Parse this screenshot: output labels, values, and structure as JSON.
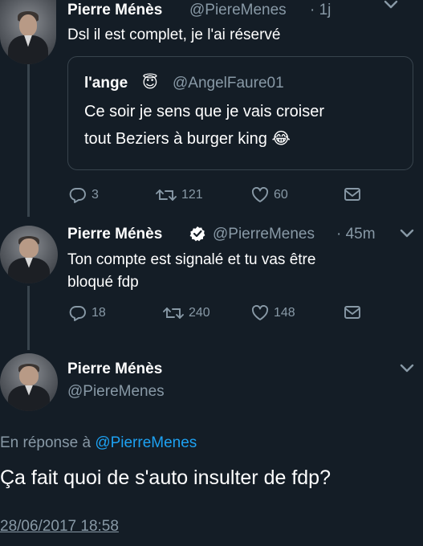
{
  "tweet1": {
    "author_name": "Pierre Ménès",
    "handle": "@PiereMenes",
    "time": "· 1j",
    "text": "Dsl il est complet, je l'ai réservé",
    "quoted": {
      "author_name": "l'ange",
      "author_emoji": "😇",
      "handle": "@AngelFaure01",
      "text_line1": "Ce soir je sens que je vais croiser",
      "text_line2": "tout Beziers à burger king",
      "text_emoji": "😂"
    },
    "replies": "3",
    "retweets": "121",
    "likes": "60"
  },
  "tweet2": {
    "author_name": "Pierre Ménès",
    "verified": true,
    "handle": "@PierreMenes",
    "time": "· 45m",
    "text_line1": "Ton compte est signalé et tu vas être",
    "text_line2": "bloqué fdp",
    "replies": "18",
    "retweets": "240",
    "likes": "148"
  },
  "tweet3": {
    "author_name": "Pierre Ménès",
    "handle": "@PiereMenes",
    "reply_prefix": "En réponse à ",
    "reply_mention": "@PierreMenes",
    "text": "Ça fait quoi de s'auto insulter de fdp?",
    "timestamp": "28/06/2017 18:58"
  },
  "colors": {
    "background": "#141d26",
    "primary_text": "#ffffff",
    "secondary_text": "#8899a6",
    "accent": "#1da1f2",
    "border": "#38444d"
  },
  "icons": {
    "reply": "reply-icon",
    "retweet": "retweet-icon",
    "like": "heart-icon",
    "dm": "envelope-icon",
    "menu": "chevron-down-icon",
    "verified": "verified-badge-icon"
  }
}
